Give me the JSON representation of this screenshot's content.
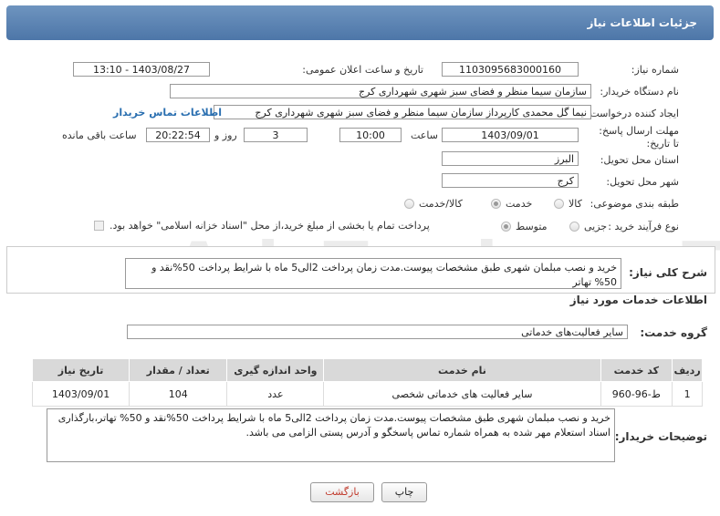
{
  "header": {
    "title": "جزئیات اطلاعات نیاز"
  },
  "form": {
    "need_number_label": "شماره نیاز:",
    "need_number": "1103095683000160",
    "announce_label": "تاریخ و ساعت اعلان عمومی:",
    "announce_value": "1403/08/27 - 13:10",
    "buyer_org_label": "نام دستگاه خریدار:",
    "buyer_org": "سازمان سیما منظر و فضای سبز شهری شهرداری کرج",
    "creator_label": "ایجاد کننده درخواست:",
    "creator": "نیما گل محمدی کارپرداز سازمان سیما منظر و فضای سبز شهری شهرداری کرج",
    "contact_link": "اطلاعات تماس خریدار",
    "deadline_label": "مهلت ارسال پاسخ: تا تاریخ:",
    "deadline_date": "1403/09/01",
    "time_label": "ساعت",
    "deadline_time": "10:00",
    "days_value": "3",
    "days_label": "روز و",
    "remaining_time": "20:22:54",
    "remaining_label": "ساعت باقی مانده",
    "province_label": "استان محل تحویل:",
    "province": "البرز",
    "city_label": "شهر محل تحویل:",
    "city": "کرج",
    "category_label": "طبقه بندی موضوعی:",
    "category_options": [
      "کالا",
      "خدمت",
      "کالا/خدمت"
    ],
    "category_selected": "خدمت",
    "process_label": "نوع فرآیند خرید :",
    "process_options": [
      "جزیی",
      "متوسط"
    ],
    "process_selected": "متوسط",
    "payment_note": "پرداخت تمام یا بخشی از مبلغ خرید،از محل \"اسناد خزانه اسلامی\" خواهد بود."
  },
  "summary": {
    "label": "شرح کلی نیاز:",
    "text": "خرید و نصب مبلمان شهری طبق مشخصات پیوست.مدت زمان پرداخت 2الی5 ماه با شرایط پرداخت 50%نقد و 50% تهاتر"
  },
  "services": {
    "section_title": "اطلاعات خدمات مورد نیاز",
    "group_label": "گروه خدمت:",
    "group_value": "سایر فعالیت‌های خدماتی",
    "columns": [
      "ردیف",
      "کد خدمت",
      "نام خدمت",
      "واحد اندازه گیری",
      "تعداد / مقدار",
      "تاریخ نیاز"
    ],
    "rows": [
      [
        "1",
        "ط-96-960",
        "سایر فعالیت های خدماتی شخصی",
        "عدد",
        "104",
        "1403/09/01"
      ]
    ]
  },
  "buyer_notes": {
    "label": "توضیحات خریدار:",
    "text": "خرید و نصب مبلمان شهری طبق مشخصات پیوست.مدت زمان پرداخت 2الی5 ماه با شرایط پرداخت 50%نقد و 50% تهاتر،بارگذاری اسناد استعلام مهر شده به همراه شماره تماس پاسخگو و آدرس پستی الزامی می باشد."
  },
  "buttons": {
    "print": "چاپ",
    "back": "بازگشت"
  },
  "watermark": "AriaTender.neT",
  "colors": {
    "header": "#5a82b3",
    "link": "#2a6fb0",
    "back_text": "#c0392b"
  }
}
